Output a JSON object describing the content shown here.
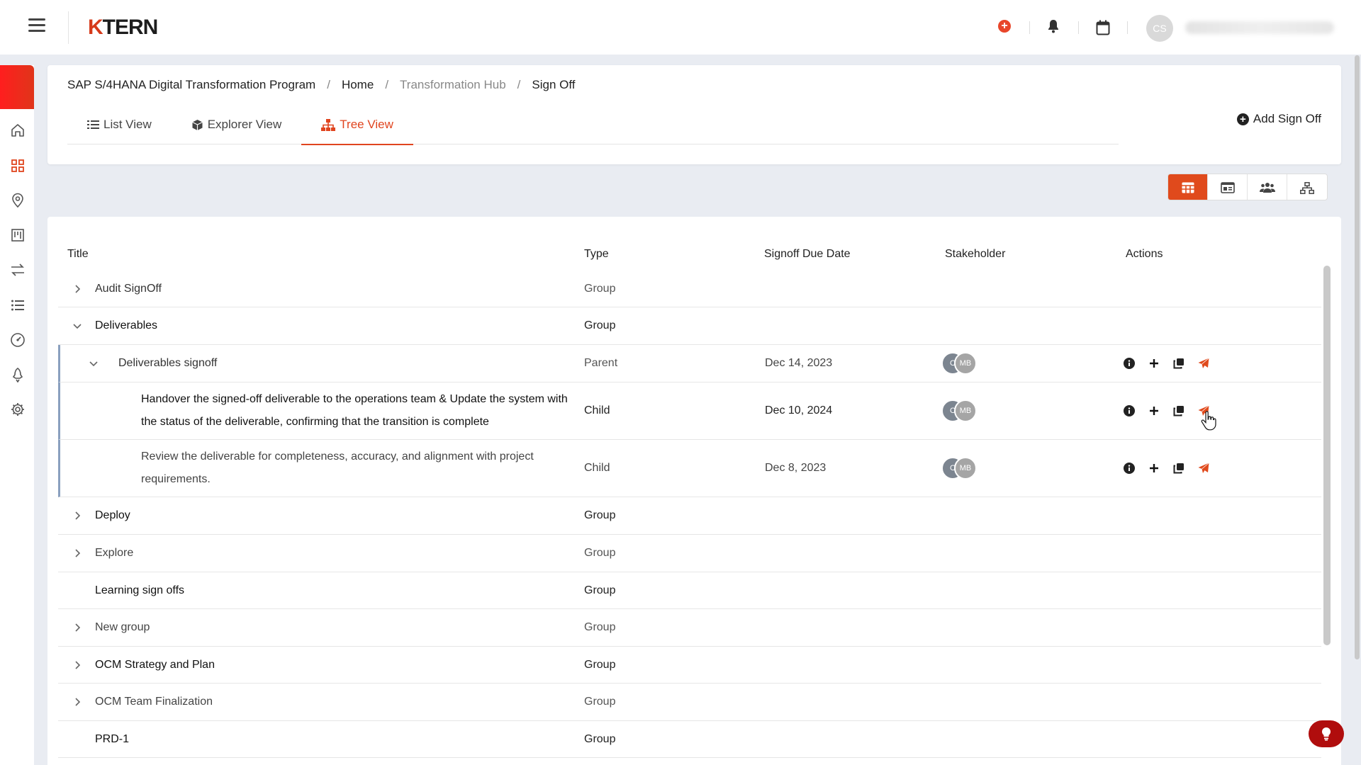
{
  "app": {
    "logo_k": "K",
    "logo_rest": "TERN",
    "user_initials": "CS"
  },
  "breadcrumb": [
    {
      "label": "SAP S/4HANA Digital Transformation Program"
    },
    {
      "label": "Home"
    },
    {
      "label": "Transformation Hub"
    },
    {
      "label": "Sign Off"
    }
  ],
  "tabs": [
    {
      "label": "List View",
      "icon": "list-icon"
    },
    {
      "label": "Explorer View",
      "icon": "cube-icon"
    },
    {
      "label": "Tree View",
      "icon": "sitemap-icon",
      "active": true
    }
  ],
  "header": {
    "add_label": "Add Sign Off"
  },
  "table": {
    "columns": {
      "title": "Title",
      "type": "Type",
      "due": "Signoff Due Date",
      "stakeholder": "Stakeholder",
      "actions": "Actions"
    },
    "rows": [
      {
        "title": "Audit SignOff",
        "type": "Group"
      },
      {
        "title": "Deliverables",
        "type": "Group"
      },
      {
        "title": "Deliverables signoff",
        "type": "Parent",
        "due": "Dec 14, 2023",
        "s1": "C",
        "s2": "MB"
      },
      {
        "title_line1": "Handover the signed-off deliverable to the operations team & Update the system with",
        "title_line2": "the status of the deliverable, confirming that the transition is complete",
        "type": "Child",
        "due": "Dec 10, 2024",
        "s1": "C",
        "s2": "MB"
      },
      {
        "title_line1": "Review the deliverable for completeness, accuracy, and alignment with project",
        "title_line2": "requirements.",
        "type": "Child",
        "due": "Dec 8, 2023",
        "s1": "C",
        "s2": "MB"
      },
      {
        "title": "Deploy",
        "type": "Group"
      },
      {
        "title": "Explore",
        "type": "Group"
      },
      {
        "title": "Learning sign offs",
        "type": "Group"
      },
      {
        "title": "New group",
        "type": "Group"
      },
      {
        "title": "OCM Strategy and Plan",
        "type": "Group"
      },
      {
        "title": "OCM Team Finalization",
        "type": "Group"
      },
      {
        "title": "PRD-1",
        "type": "Group"
      }
    ]
  },
  "colors": {
    "accent": "#e0451f",
    "brand_red": "#d63a1b"
  }
}
